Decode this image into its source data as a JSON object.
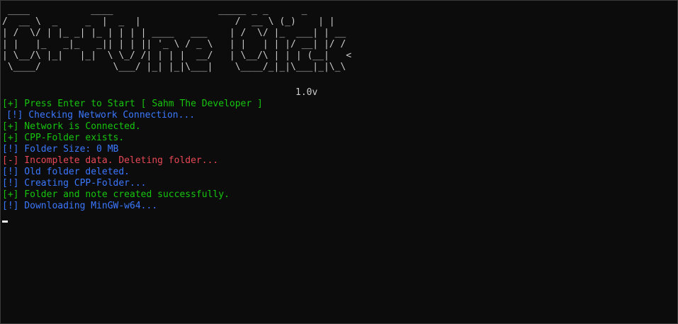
{
  "banner": {
    "ascii_art": " ____           ____                   _____ _ _      _\n/  __ \\  _     _  |  _  |                 /  __ \\ (_)    | |\n| /  \\/ | |_ _| |_ | | | | ____   ___    | /  \\/ |_  ___| | __\n| |   |_   _|_   _|| | | || '_ \\ / _ \\   | |   | | |/ __| |/ /\n| \\__/\\ |_|   |_|  \\ \\_/ /| | | |  __/   | \\__/\\ | | | (__|   <\n \\____/             \\___/ |_| |_|\\___|    \\____/_|_|\\___|_|\\_\\",
    "version": "1.0v"
  },
  "log": [
    {
      "text": "[+] Press Enter to Start [ Sahm The Developer ]",
      "level": "success"
    },
    {
      "text": "[!] Checking Network Connection...",
      "level": "info"
    },
    {
      "text": "[+] Network is Connected.",
      "level": "success"
    },
    {
      "text": "[+] CPP-Folder exists.",
      "level": "success"
    },
    {
      "text": "[!] Folder Size: 0 MB",
      "level": "info"
    },
    {
      "text": "[-] Incomplete data. Deleting folder...",
      "level": "error"
    },
    {
      "text": "[!] Old folder deleted.",
      "level": "info"
    },
    {
      "text": "[!] Creating CPP-Folder...",
      "level": "info"
    },
    {
      "text": "[+] Folder and note created successfully.",
      "level": "success"
    },
    {
      "text": "[!] Downloading MinGW-w64...",
      "level": "info"
    }
  ],
  "colors": {
    "background": "#0c0c0c",
    "default_text": "#cccccc",
    "success": "#16c60c",
    "info": "#3b78ff",
    "error": "#e74856"
  }
}
